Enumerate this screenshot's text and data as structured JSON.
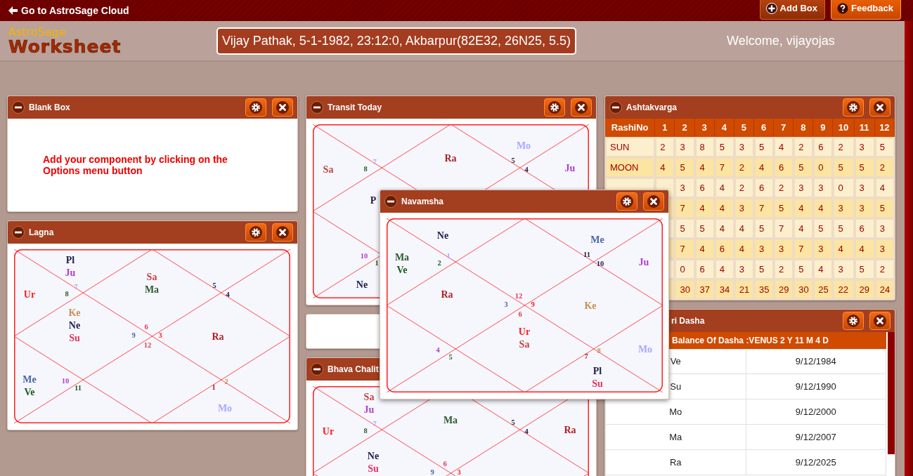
{
  "top_bar": {
    "back_link": "Go to AstroSage Cloud",
    "buttons": [
      {
        "label": "Add Box",
        "kind": "add"
      },
      {
        "label": "Feedback",
        "kind": "help"
      }
    ]
  },
  "header": {
    "logo_top": "AstroSage",
    "logo_main": "Worksheet",
    "birth_details": "Vijay Pathak, 5-1-1982, 23:12:0, Akbarpur(82E32, 26N25, 5.5)",
    "welcome": "Welcome, vijayojas"
  },
  "columns": [
    [
      {
        "kind": "note",
        "title": "Blank Box",
        "minus_button": true,
        "controls": true,
        "text": "Add your component by clicking on the Options menu button"
      },
      {
        "kind": "chart",
        "title": "Lagna",
        "minus_button": true,
        "controls": true,
        "houses": {
          "house_1": {
            "number": "6",
            "color": "#e8305a",
            "planets": [
              {
                "name": "Sa",
                "color": "#c8403a"
              },
              {
                "name": "Ma",
                "color": "#2a5a2a"
              }
            ]
          },
          "house_2": {
            "number": "7",
            "color": "#a8a8ff",
            "planets": [
              {
                "name": "Pl",
                "color": "#202040"
              },
              {
                "name": "Ju",
                "color": "#b040c8"
              }
            ]
          },
          "house_3": {
            "number": "8",
            "color": "#2a5a2a",
            "planets": [
              {
                "name": "Ur",
                "color": "#ff1a1a"
              }
            ]
          },
          "house_4": {
            "number": "9",
            "color": "#4a64a8",
            "planets": [
              {
                "name": "Ke",
                "color": "#c89050"
              },
              {
                "name": "Ne",
                "color": "#202050"
              },
              {
                "name": "Su",
                "color": "#e8305a"
              }
            ]
          },
          "house_5": {
            "number": "10",
            "color": "#b040c8",
            "planets": [
              {
                "name": "Me",
                "color": "#4a64a8"
              },
              {
                "name": "Ve",
                "color": "#1a5a1a"
              }
            ]
          },
          "house_6": {
            "number": "11",
            "color": "#1a5a1a"
          },
          "house_7": {
            "number": "12",
            "color": "#e04050"
          },
          "house_8": {
            "number": "1",
            "color": "#b02020",
            "planets": [
              {
                "name": "Mo",
                "color": "#a8a8ff"
              }
            ]
          },
          "house_9": {
            "number": "2",
            "color": "#c89050"
          },
          "house_10": {
            "number": "3",
            "color": "#ff1a1a",
            "planets": [
              {
                "name": "Ra",
                "color": "#b02020"
              }
            ]
          },
          "house_11": {
            "number": "4",
            "color": "#202050"
          },
          "house_12": {
            "number": "5",
            "color": "#202040"
          }
        }
      }
    ],
    [
      {
        "kind": "chart",
        "title": "Transit Today",
        "minus_button": true,
        "controls": true,
        "houses": {
          "house_1": {
            "planets": [
              {
                "name": "Ra",
                "color": "#b02020"
              }
            ]
          },
          "house_2": {
            "number": "7",
            "color": "#a8a8ff"
          },
          "house_3": {
            "number": "8",
            "color": "#2a5a2a",
            "planets": [
              {
                "name": "Sa",
                "color": "#c8403a"
              }
            ]
          },
          "house_4": {
            "planets": [
              {
                "name": "P",
                "color": "#202040"
              }
            ]
          },
          "house_5": {
            "number": "10",
            "color": "#b040c8"
          },
          "house_6": {
            "number": "1",
            "color": "#1a5a1a",
            "planets": [
              {
                "name": "Ne",
                "color": "#202050"
              }
            ]
          },
          "house_11": {
            "number": "4",
            "color": "#202050",
            "planets": [
              {
                "name": "Ju",
                "color": "#b040c8"
              }
            ]
          },
          "house_12": {
            "number": "5",
            "color": "#202040",
            "planets": [
              {
                "name": "Mo",
                "color": "#a8a8ff"
              }
            ]
          }
        }
      },
      {
        "kind": "empty"
      },
      {
        "kind": "chart",
        "title": "Bhava Chalit",
        "minus_button": true,
        "controls": false,
        "houses": {
          "house_1": {
            "number": "6",
            "color": "#e8305a",
            "planets": [
              {
                "name": "Ma",
                "color": "#2a5a2a"
              }
            ]
          },
          "house_2": {
            "number": "7",
            "color": "#a8a8ff",
            "planets": [
              {
                "name": "Sa",
                "color": "#c8403a"
              },
              {
                "name": "Ju",
                "color": "#b040c8"
              }
            ]
          },
          "house_3": {
            "number": "8",
            "color": "#2a5a2a",
            "planets": [
              {
                "name": "Ur",
                "color": "#ff1a1a"
              }
            ]
          },
          "house_4": {
            "number": "9",
            "color": "#4a64a8",
            "planets": [
              {
                "name": "Ne",
                "color": "#202050"
              },
              {
                "name": "Su",
                "color": "#e8305a"
              }
            ]
          },
          "house_10": {
            "number": "3",
            "color": "#ff1a1a"
          },
          "house_11": {
            "number": "4",
            "color": "#202050",
            "planets": [
              {
                "name": "Ra",
                "color": "#b02020"
              }
            ]
          },
          "house_12": {
            "number": "5",
            "color": "#202040"
          }
        }
      }
    ],
    [
      {
        "kind": "table",
        "title": "Ashtakvarga",
        "minus_button": true,
        "controls": true,
        "columns": [
          "RashiNo",
          "1",
          "2",
          "3",
          "4",
          "5",
          "6",
          "7",
          "8",
          "9",
          "10",
          "11",
          "12"
        ],
        "rows": [
          {
            "label": "SUN",
            "values": [
              "2",
              "3",
              "8",
              "5",
              "3",
              "5",
              "4",
              "2",
              "6",
              "2",
              "3",
              "5"
            ]
          },
          {
            "label": "MOON",
            "values": [
              "4",
              "5",
              "4",
              "7",
              "2",
              "4",
              "6",
              "5",
              "0",
              "5",
              "5",
              "2"
            ]
          },
          {
            "values": [
              "3",
              "6",
              "4",
              "2",
              "6",
              "2",
              "3",
              "3",
              "0",
              "3",
              "4"
            ]
          },
          {
            "values": [
              "7",
              "4",
              "4",
              "3",
              "7",
              "5",
              "4",
              "4",
              "3",
              "3",
              "5"
            ]
          },
          {
            "values": [
              "5",
              "5",
              "4",
              "4",
              "5",
              "7",
              "4",
              "5",
              "5",
              "6",
              "3"
            ]
          },
          {
            "values": [
              "7",
              "4",
              "6",
              "4",
              "3",
              "3",
              "7",
              "3",
              "4",
              "4",
              "3"
            ]
          },
          {
            "values": [
              "0",
              "6",
              "4",
              "3",
              "5",
              "2",
              "5",
              "4",
              "3",
              "5",
              "2"
            ]
          },
          {
            "values": [
              "30",
              "37",
              "34",
              "21",
              "35",
              "29",
              "30",
              "25",
              "22",
              "29",
              "24"
            ]
          }
        ]
      },
      {
        "kind": "dasha",
        "title": "ri Dasha",
        "minus_button": false,
        "controls": true,
        "balance": "Balance Of Dasha :VENUS 2 Y 11 M 4 D",
        "rows": [
          {
            "planet": "Ve",
            "date": "9/12/1984"
          },
          {
            "planet": "Su",
            "date": "9/12/1990"
          },
          {
            "planet": "Mo",
            "date": "9/12/2000"
          },
          {
            "planet": "Ma",
            "date": "9/12/2007"
          },
          {
            "planet": "Ra",
            "date": "9/12/2025"
          }
        ]
      }
    ]
  ],
  "overlay": {
    "kind": "chart",
    "title": "Navamsha",
    "minus_button": true,
    "controls": true,
    "houses": {
      "house_1": {
        "number": "12",
        "color": "#e8305a"
      },
      "house_2": {
        "number": "1",
        "color": "#a8a8ff",
        "planets": [
          {
            "name": "Ne",
            "color": "#202050"
          }
        ]
      },
      "house_3": {
        "number": "2",
        "color": "#2a5a2a",
        "planets": [
          {
            "name": "Ma",
            "color": "#2a5a2a"
          },
          {
            "name": "Ve",
            "color": "#1a5a1a"
          }
        ]
      },
      "house_4": {
        "number": "3",
        "color": "#4a64a8",
        "planets": [
          {
            "name": "Ra",
            "color": "#b02020"
          }
        ]
      },
      "house_5": {
        "number": "4",
        "color": "#b040c8"
      },
      "house_6": {
        "number": "5",
        "color": "#2a6a2a"
      },
      "house_7": {
        "number": "6",
        "color": "#c8403a",
        "planets": [
          {
            "name": "Ur",
            "color": "#ff1a1a"
          },
          {
            "name": "Sa",
            "color": "#c8403a"
          }
        ]
      },
      "house_8": {
        "number": "7",
        "color": "#b02020",
        "planets": [
          {
            "name": "Pl",
            "color": "#202040"
          },
          {
            "name": "Su",
            "color": "#e8305a"
          }
        ]
      },
      "house_9": {
        "number": "8",
        "color": "#c89050",
        "planets": [
          {
            "name": "Mo",
            "color": "#a8a8ff"
          }
        ]
      },
      "house_10": {
        "number": "9",
        "color": "#ff1a1a",
        "planets": [
          {
            "name": "Ke",
            "color": "#c89050"
          }
        ]
      },
      "house_11": {
        "number": "10",
        "color": "#202050",
        "planets": [
          {
            "name": "Ju",
            "color": "#b040c8"
          }
        ]
      },
      "house_12": {
        "number": "11",
        "color": "#202040",
        "planets": [
          {
            "name": "Me",
            "color": "#4a64a8"
          }
        ]
      }
    }
  }
}
